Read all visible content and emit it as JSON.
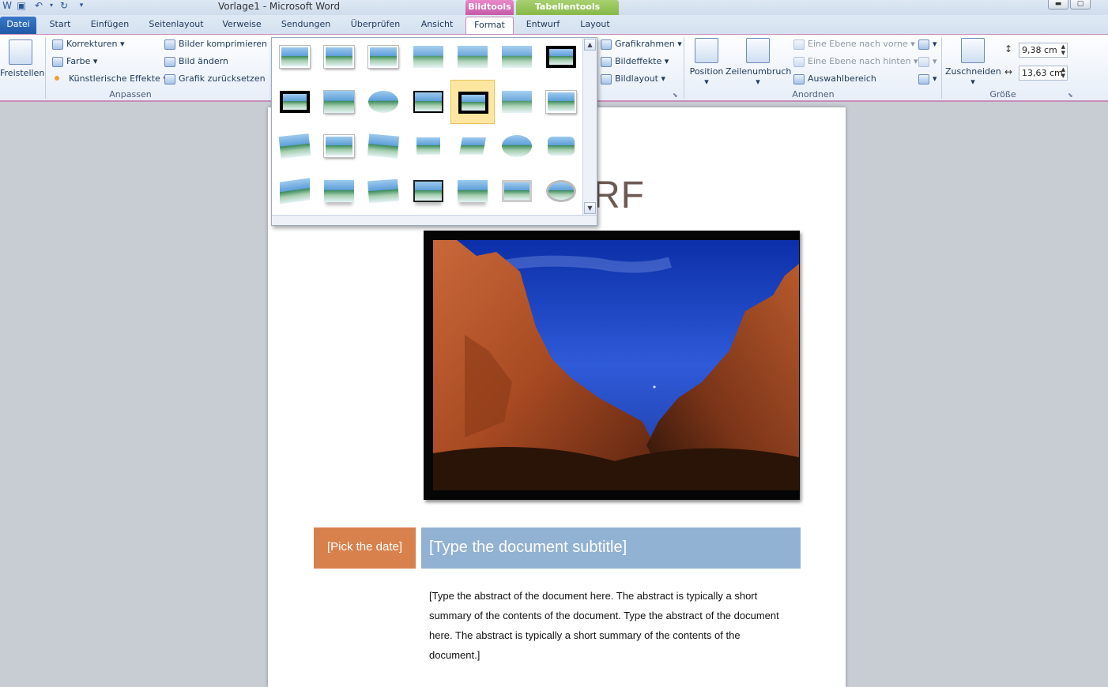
{
  "window": {
    "title": "Vorlage1  -  Microsoft Word",
    "minimize": "▬",
    "maximize": "▢"
  },
  "context_tabs": {
    "bildtools": "Bildtools",
    "tabellentools": "Tabellentools"
  },
  "tabs": [
    {
      "label": "Datei"
    },
    {
      "label": "Start"
    },
    {
      "label": "Einfügen"
    },
    {
      "label": "Seitenlayout"
    },
    {
      "label": "Verweise"
    },
    {
      "label": "Sendungen"
    },
    {
      "label": "Überprüfen"
    },
    {
      "label": "Ansicht"
    },
    {
      "label": "Format"
    },
    {
      "label": "Entwurf"
    },
    {
      "label": "Layout"
    }
  ],
  "ribbon": {
    "freistellen": "Freistellen",
    "anpassen": {
      "korrekturen": "Korrekturen",
      "farbe": "Farbe",
      "kuenstlerisch": "Künstlerische Effekte",
      "komprimieren": "Bilder komprimieren",
      "aendern": "Bild ändern",
      "zuruecksetzen": "Grafik zurücksetzen",
      "label": "Anpassen"
    },
    "bildformat": {
      "rahmen": "Grafikrahmen",
      "effekte": "Bildeffekte",
      "layout": "Bildlayout"
    },
    "anordnen": {
      "position": "Position",
      "zeilenumbruch": "Zeilenumbruch",
      "vorne": "Eine Ebene nach vorne",
      "hinten": "Eine Ebene nach hinten",
      "auswahl": "Auswahlbereich",
      "label": "Anordnen"
    },
    "groesse": {
      "zuschneiden": "Zuschneiden",
      "hoehe": "9,38  cm",
      "breite": "13,63  cm",
      "label": "Größe"
    }
  },
  "document": {
    "title_fragment": "RF",
    "date_placeholder": "[Pick the date]",
    "subtitle_placeholder": "[Type the document subtitle]",
    "abstract": "[Type the abstract of the document here. The abstract is typically a short summary of the contents of the document. Type the abstract of the document here. The abstract is typically a short summary of the contents of the document.]"
  }
}
